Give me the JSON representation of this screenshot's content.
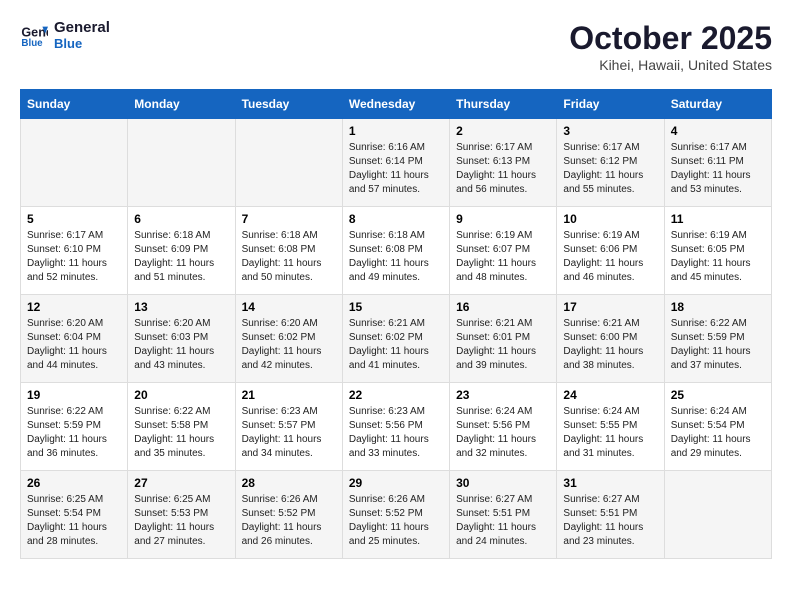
{
  "header": {
    "logo_line1": "General",
    "logo_line2": "Blue",
    "month": "October 2025",
    "location": "Kihei, Hawaii, United States"
  },
  "weekdays": [
    "Sunday",
    "Monday",
    "Tuesday",
    "Wednesday",
    "Thursday",
    "Friday",
    "Saturday"
  ],
  "weeks": [
    [
      {
        "day": "",
        "sunrise": "",
        "sunset": "",
        "daylight": ""
      },
      {
        "day": "",
        "sunrise": "",
        "sunset": "",
        "daylight": ""
      },
      {
        "day": "",
        "sunrise": "",
        "sunset": "",
        "daylight": ""
      },
      {
        "day": "1",
        "sunrise": "Sunrise: 6:16 AM",
        "sunset": "Sunset: 6:14 PM",
        "daylight": "Daylight: 11 hours and 57 minutes."
      },
      {
        "day": "2",
        "sunrise": "Sunrise: 6:17 AM",
        "sunset": "Sunset: 6:13 PM",
        "daylight": "Daylight: 11 hours and 56 minutes."
      },
      {
        "day": "3",
        "sunrise": "Sunrise: 6:17 AM",
        "sunset": "Sunset: 6:12 PM",
        "daylight": "Daylight: 11 hours and 55 minutes."
      },
      {
        "day": "4",
        "sunrise": "Sunrise: 6:17 AM",
        "sunset": "Sunset: 6:11 PM",
        "daylight": "Daylight: 11 hours and 53 minutes."
      }
    ],
    [
      {
        "day": "5",
        "sunrise": "Sunrise: 6:17 AM",
        "sunset": "Sunset: 6:10 PM",
        "daylight": "Daylight: 11 hours and 52 minutes."
      },
      {
        "day": "6",
        "sunrise": "Sunrise: 6:18 AM",
        "sunset": "Sunset: 6:09 PM",
        "daylight": "Daylight: 11 hours and 51 minutes."
      },
      {
        "day": "7",
        "sunrise": "Sunrise: 6:18 AM",
        "sunset": "Sunset: 6:08 PM",
        "daylight": "Daylight: 11 hours and 50 minutes."
      },
      {
        "day": "8",
        "sunrise": "Sunrise: 6:18 AM",
        "sunset": "Sunset: 6:08 PM",
        "daylight": "Daylight: 11 hours and 49 minutes."
      },
      {
        "day": "9",
        "sunrise": "Sunrise: 6:19 AM",
        "sunset": "Sunset: 6:07 PM",
        "daylight": "Daylight: 11 hours and 48 minutes."
      },
      {
        "day": "10",
        "sunrise": "Sunrise: 6:19 AM",
        "sunset": "Sunset: 6:06 PM",
        "daylight": "Daylight: 11 hours and 46 minutes."
      },
      {
        "day": "11",
        "sunrise": "Sunrise: 6:19 AM",
        "sunset": "Sunset: 6:05 PM",
        "daylight": "Daylight: 11 hours and 45 minutes."
      }
    ],
    [
      {
        "day": "12",
        "sunrise": "Sunrise: 6:20 AM",
        "sunset": "Sunset: 6:04 PM",
        "daylight": "Daylight: 11 hours and 44 minutes."
      },
      {
        "day": "13",
        "sunrise": "Sunrise: 6:20 AM",
        "sunset": "Sunset: 6:03 PM",
        "daylight": "Daylight: 11 hours and 43 minutes."
      },
      {
        "day": "14",
        "sunrise": "Sunrise: 6:20 AM",
        "sunset": "Sunset: 6:02 PM",
        "daylight": "Daylight: 11 hours and 42 minutes."
      },
      {
        "day": "15",
        "sunrise": "Sunrise: 6:21 AM",
        "sunset": "Sunset: 6:02 PM",
        "daylight": "Daylight: 11 hours and 41 minutes."
      },
      {
        "day": "16",
        "sunrise": "Sunrise: 6:21 AM",
        "sunset": "Sunset: 6:01 PM",
        "daylight": "Daylight: 11 hours and 39 minutes."
      },
      {
        "day": "17",
        "sunrise": "Sunrise: 6:21 AM",
        "sunset": "Sunset: 6:00 PM",
        "daylight": "Daylight: 11 hours and 38 minutes."
      },
      {
        "day": "18",
        "sunrise": "Sunrise: 6:22 AM",
        "sunset": "Sunset: 5:59 PM",
        "daylight": "Daylight: 11 hours and 37 minutes."
      }
    ],
    [
      {
        "day": "19",
        "sunrise": "Sunrise: 6:22 AM",
        "sunset": "Sunset: 5:59 PM",
        "daylight": "Daylight: 11 hours and 36 minutes."
      },
      {
        "day": "20",
        "sunrise": "Sunrise: 6:22 AM",
        "sunset": "Sunset: 5:58 PM",
        "daylight": "Daylight: 11 hours and 35 minutes."
      },
      {
        "day": "21",
        "sunrise": "Sunrise: 6:23 AM",
        "sunset": "Sunset: 5:57 PM",
        "daylight": "Daylight: 11 hours and 34 minutes."
      },
      {
        "day": "22",
        "sunrise": "Sunrise: 6:23 AM",
        "sunset": "Sunset: 5:56 PM",
        "daylight": "Daylight: 11 hours and 33 minutes."
      },
      {
        "day": "23",
        "sunrise": "Sunrise: 6:24 AM",
        "sunset": "Sunset: 5:56 PM",
        "daylight": "Daylight: 11 hours and 32 minutes."
      },
      {
        "day": "24",
        "sunrise": "Sunrise: 6:24 AM",
        "sunset": "Sunset: 5:55 PM",
        "daylight": "Daylight: 11 hours and 31 minutes."
      },
      {
        "day": "25",
        "sunrise": "Sunrise: 6:24 AM",
        "sunset": "Sunset: 5:54 PM",
        "daylight": "Daylight: 11 hours and 29 minutes."
      }
    ],
    [
      {
        "day": "26",
        "sunrise": "Sunrise: 6:25 AM",
        "sunset": "Sunset: 5:54 PM",
        "daylight": "Daylight: 11 hours and 28 minutes."
      },
      {
        "day": "27",
        "sunrise": "Sunrise: 6:25 AM",
        "sunset": "Sunset: 5:53 PM",
        "daylight": "Daylight: 11 hours and 27 minutes."
      },
      {
        "day": "28",
        "sunrise": "Sunrise: 6:26 AM",
        "sunset": "Sunset: 5:52 PM",
        "daylight": "Daylight: 11 hours and 26 minutes."
      },
      {
        "day": "29",
        "sunrise": "Sunrise: 6:26 AM",
        "sunset": "Sunset: 5:52 PM",
        "daylight": "Daylight: 11 hours and 25 minutes."
      },
      {
        "day": "30",
        "sunrise": "Sunrise: 6:27 AM",
        "sunset": "Sunset: 5:51 PM",
        "daylight": "Daylight: 11 hours and 24 minutes."
      },
      {
        "day": "31",
        "sunrise": "Sunrise: 6:27 AM",
        "sunset": "Sunset: 5:51 PM",
        "daylight": "Daylight: 11 hours and 23 minutes."
      },
      {
        "day": "",
        "sunrise": "",
        "sunset": "",
        "daylight": ""
      }
    ]
  ]
}
